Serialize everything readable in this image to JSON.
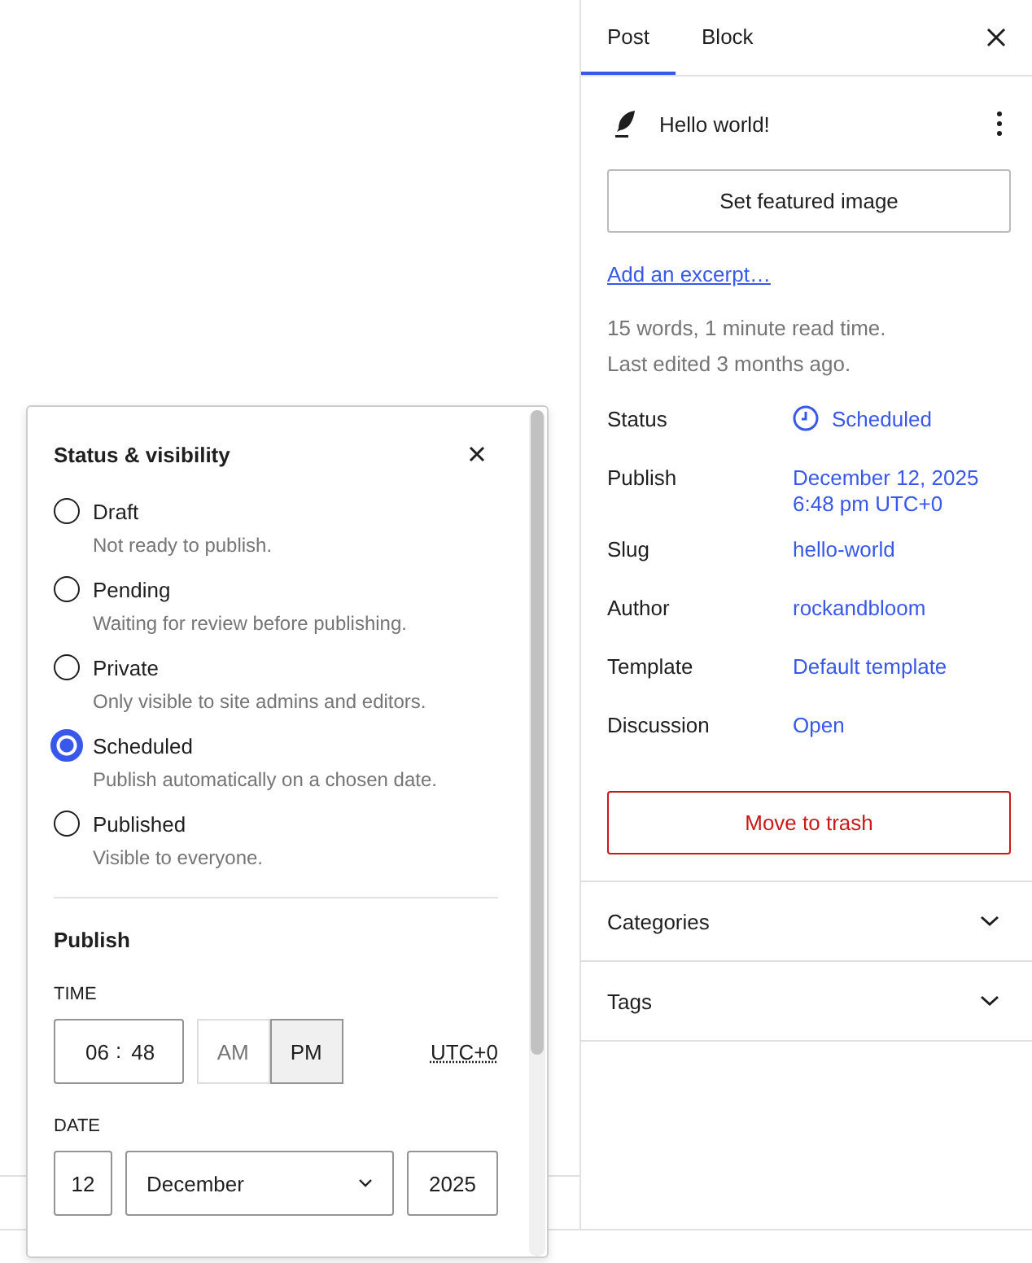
{
  "sidebar": {
    "tabs": [
      {
        "label": "Post",
        "selected": true
      },
      {
        "label": "Block",
        "selected": false
      }
    ],
    "post": {
      "title": "Hello world!",
      "featured_image_button": "Set featured image",
      "excerpt_link": "Add an excerpt…",
      "stats": [
        "15 words, 1 minute read time.",
        "Last edited 3 months ago."
      ]
    },
    "fields": [
      {
        "label": "Status",
        "kind": "status",
        "lines": [
          "Scheduled"
        ]
      },
      {
        "label": "Publish",
        "kind": "link",
        "lines": [
          "December 12, 2025",
          "6:48 pm UTC+0"
        ]
      },
      {
        "label": "Slug",
        "kind": "link",
        "lines": [
          "hello-world"
        ]
      },
      {
        "label": "Author",
        "kind": "link",
        "lines": [
          "rockandbloom"
        ]
      },
      {
        "label": "Template",
        "kind": "link",
        "lines": [
          "Default template"
        ]
      },
      {
        "label": "Discussion",
        "kind": "link",
        "lines": [
          "Open"
        ]
      }
    ],
    "trash_button": "Move to trash",
    "panels": [
      {
        "title": "Categories",
        "expanded": false
      },
      {
        "title": "Tags",
        "expanded": false
      }
    ]
  },
  "popover": {
    "title": "Status & visibility",
    "options": [
      {
        "label": "Draft",
        "description": "Not ready to publish.",
        "selected": false
      },
      {
        "label": "Pending",
        "description": "Waiting for review before publishing.",
        "selected": false
      },
      {
        "label": "Private",
        "description": "Only visible to site admins and editors.",
        "selected": false
      },
      {
        "label": "Scheduled",
        "description": "Publish automatically on a chosen date.",
        "selected": true
      },
      {
        "label": "Published",
        "description": "Visible to everyone.",
        "selected": false
      }
    ],
    "publish": {
      "heading": "Publish",
      "time_label": "TIME",
      "hour": "06",
      "time_separator": ":",
      "minute": "48",
      "meridiem": [
        {
          "label": "AM",
          "selected": false
        },
        {
          "label": "PM",
          "selected": true
        }
      ],
      "timezone": "UTC+0",
      "date_label": "DATE",
      "day": "12",
      "month": "December",
      "year": "2025"
    }
  }
}
